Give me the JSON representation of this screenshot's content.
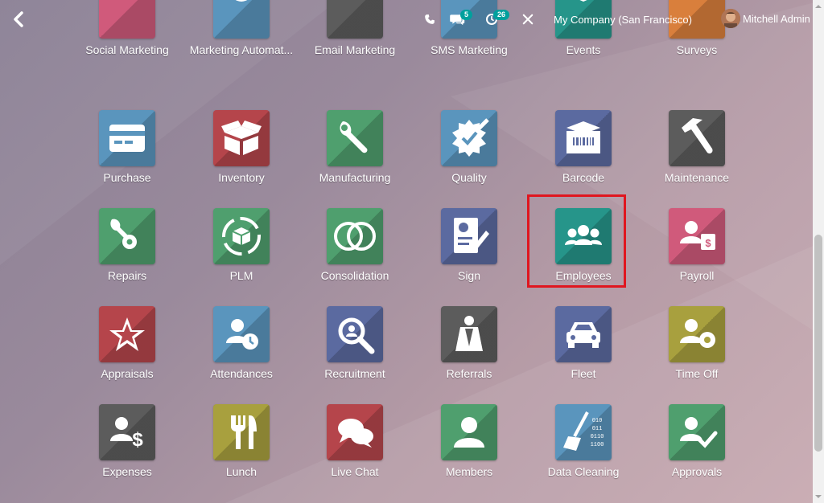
{
  "topbar": {
    "phone_icon": "phone-icon",
    "chat_count": "5",
    "activity_count": "26",
    "company": "My Company (San Francisco)",
    "user_name": "Mitchell Admin"
  },
  "apps": {
    "row0": [
      {
        "label": "Social Marketing",
        "color": "#d05a7b",
        "icon": "social-marketing-icon"
      },
      {
        "label": "Marketing Automat...",
        "color": "#5a95bd",
        "icon": "marketing-automation-icon"
      },
      {
        "label": "Email Marketing",
        "color": "#5c5c5c",
        "icon": "email-marketing-icon"
      },
      {
        "label": "SMS Marketing",
        "color": "#5a95bd",
        "icon": "sms-marketing-icon"
      },
      {
        "label": "Events",
        "color": "#26958a",
        "icon": "events-icon"
      },
      {
        "label": "Surveys",
        "color": "#d97f3c",
        "icon": "surveys-icon"
      }
    ],
    "row1": [
      {
        "label": "Purchase",
        "color": "#5a95bd",
        "icon": "purchase-icon"
      },
      {
        "label": "Inventory",
        "color": "#b5454b",
        "icon": "inventory-icon"
      },
      {
        "label": "Manufacturing",
        "color": "#4f9f6e",
        "icon": "manufacturing-icon"
      },
      {
        "label": "Quality",
        "color": "#5a95bd",
        "icon": "quality-icon"
      },
      {
        "label": "Barcode",
        "color": "#5b6aa0",
        "icon": "barcode-icon"
      },
      {
        "label": "Maintenance",
        "color": "#5c5c5c",
        "icon": "maintenance-icon"
      }
    ],
    "row2": [
      {
        "label": "Repairs",
        "color": "#4f9f6e",
        "icon": "repairs-icon"
      },
      {
        "label": "PLM",
        "color": "#4f9f6e",
        "icon": "plm-icon"
      },
      {
        "label": "Consolidation",
        "color": "#4f9f6e",
        "icon": "consolidation-icon"
      },
      {
        "label": "Sign",
        "color": "#5b6aa0",
        "icon": "sign-icon"
      },
      {
        "label": "Employees",
        "color": "#26958a",
        "icon": "employees-icon"
      },
      {
        "label": "Payroll",
        "color": "#d05a7b",
        "icon": "payroll-icon"
      }
    ],
    "row3": [
      {
        "label": "Appraisals",
        "color": "#b5454b",
        "icon": "appraisals-icon"
      },
      {
        "label": "Attendances",
        "color": "#5a95bd",
        "icon": "attendances-icon"
      },
      {
        "label": "Recruitment",
        "color": "#5b6aa0",
        "icon": "recruitment-icon"
      },
      {
        "label": "Referrals",
        "color": "#5c5c5c",
        "icon": "referrals-icon"
      },
      {
        "label": "Fleet",
        "color": "#5b6aa0",
        "icon": "fleet-icon"
      },
      {
        "label": "Time Off",
        "color": "#a8a03e",
        "icon": "time-off-icon"
      }
    ],
    "row4": [
      {
        "label": "Expenses",
        "color": "#5c5c5c",
        "icon": "expenses-icon"
      },
      {
        "label": "Lunch",
        "color": "#a8a03e",
        "icon": "lunch-icon"
      },
      {
        "label": "Live Chat",
        "color": "#b5454b",
        "icon": "live-chat-icon"
      },
      {
        "label": "Members",
        "color": "#4f9f6e",
        "icon": "members-icon"
      },
      {
        "label": "Data Cleaning",
        "color": "#5a95bd",
        "icon": "data-cleaning-icon"
      },
      {
        "label": "Approvals",
        "color": "#4f9f6e",
        "icon": "approvals-icon"
      }
    ]
  },
  "highlighted_app": "Employees"
}
